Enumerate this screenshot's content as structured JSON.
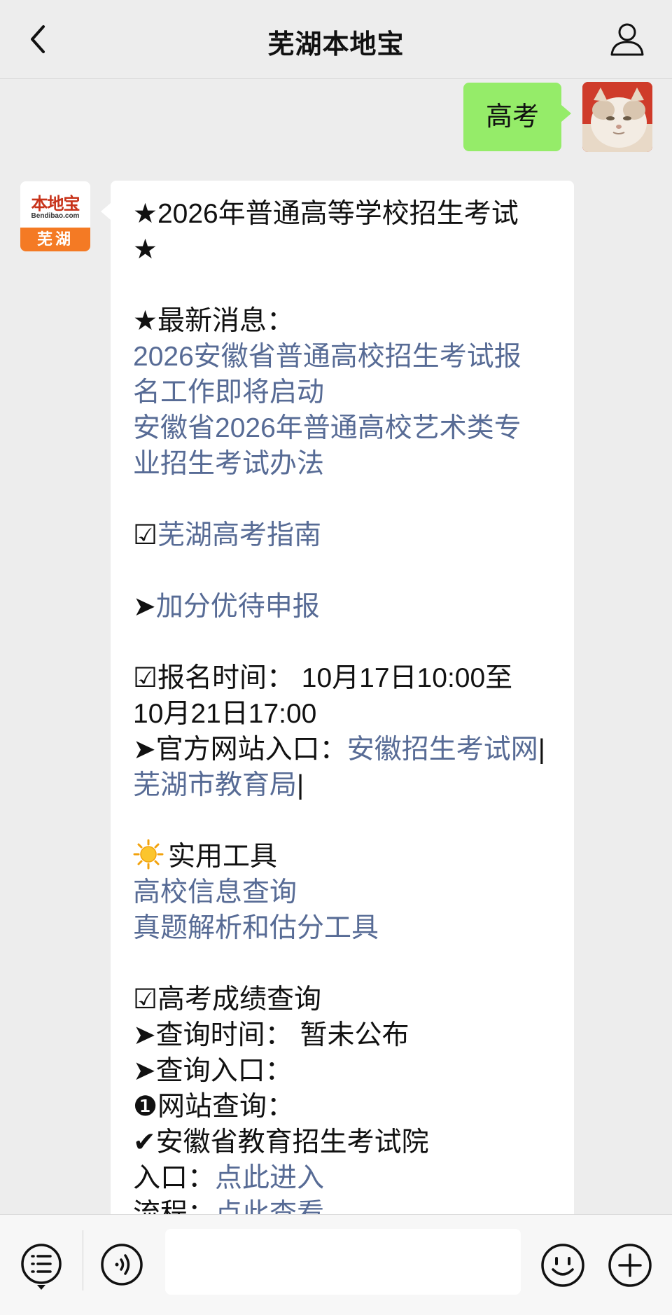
{
  "header": {
    "title": "芜湖本地宝"
  },
  "user_message": {
    "text": "高考"
  },
  "bot_avatar": {
    "brand": "本地宝",
    "url": "Bendibao.com",
    "city": "芜湖"
  },
  "bot_message": {
    "l1": "★2026年普通高等学校招生考试",
    "l2": "★",
    "l3": "★最新消息：",
    "l4": "2026安徽省普通高校招生考试报",
    "l5": "名工作即将启动",
    "l6": "安徽省2026年普通高校艺术类专",
    "l7": "业招生考试办法",
    "l8_prefix": "☑",
    "l8_link": "芜湖高考指南",
    "l9_prefix": "➤",
    "l9_link": "加分优待申报",
    "l10": "☑报名时间：  10月17日10:00至",
    "l11": "10月21日17:00",
    "l12_prefix": "➤官方网站入口：",
    "l12_link": "安徽招生考试网",
    "l12_sep": "|",
    "l13_link": "芜湖市教育局",
    "l13_sep": "|",
    "l14": "实用工具",
    "l15": "高校信息查询",
    "l16": "真题解析和估分工具",
    "l17": "☑高考成绩查询",
    "l18": "➤查询时间：  暂未公布",
    "l19": "➤查询入口：",
    "l20": "❶网站查询：",
    "l21": "✔安徽省教育招生考试院",
    "l22_prefix": "入口：",
    "l22_link": "点此进入",
    "l23_prefix": "流程：",
    "l23_link": "点此查看"
  },
  "icons": {
    "back": "chevron-left-icon",
    "profile": "person-icon",
    "menu": "menu-list-icon",
    "voice": "voice-icon",
    "emoji": "emoji-icon",
    "plus": "plus-icon",
    "sun": "sun-emoji-icon"
  },
  "colors": {
    "background": "#ededed",
    "user_bubble": "#95ec69",
    "link": "#576b95",
    "avatar_orange": "#f47a24",
    "brand_red": "#c8331a"
  }
}
